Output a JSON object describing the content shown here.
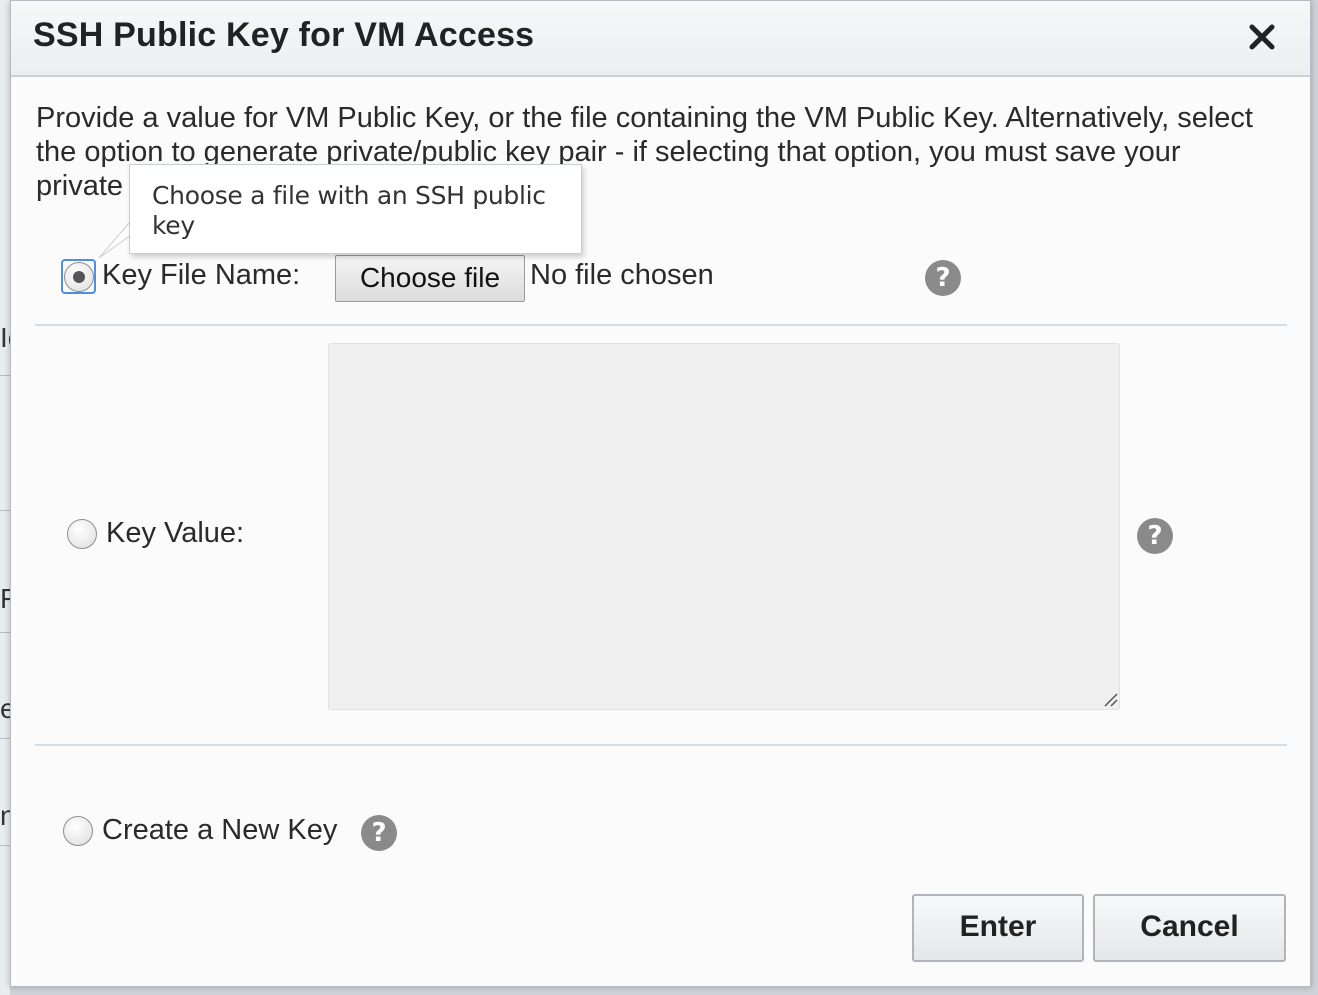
{
  "background": {
    "fragments": [
      "Ic",
      "F",
      "e",
      "n"
    ]
  },
  "dialog": {
    "title": "SSH Public Key for VM Access",
    "close_glyph": "close-icon",
    "description": "Provide a value for VM Public Key, or the file containing the VM Public Key. Alternatively, select the option to generate private/public key pair - if selecting that option, you must save your private key",
    "tooltip": "Choose a file with an SSH public key",
    "options": {
      "key_file": {
        "label": "Key File Name:",
        "selected": true,
        "button_label": "Choose file",
        "status": "No file chosen",
        "help_glyph": "?"
      },
      "key_value": {
        "label": "Key Value:",
        "selected": false,
        "value": "",
        "help_glyph": "?"
      },
      "create_new": {
        "label": "Create a New Key",
        "selected": false,
        "help_glyph": "?"
      }
    },
    "buttons": {
      "enter": "Enter",
      "cancel": "Cancel"
    }
  },
  "colors": {
    "focus_ring": "#4f8de0",
    "help_icon_bg": "#8a8a8a",
    "textarea_bg": "#efeff0",
    "divider": "#d3dde6"
  }
}
